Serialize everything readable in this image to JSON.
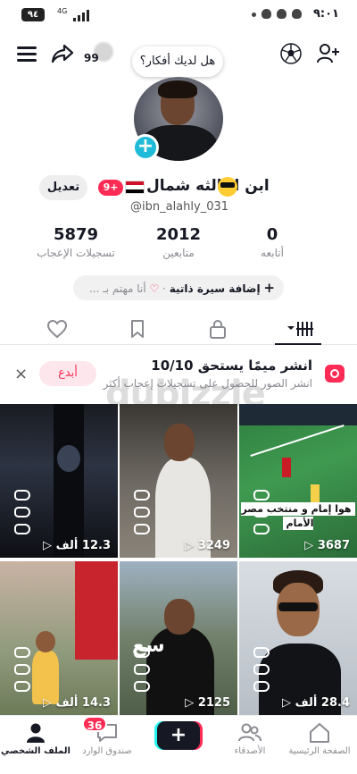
{
  "status_bar": {
    "battery": "٩٤",
    "network": "4G",
    "time": "٩:٠١"
  },
  "header": {
    "visitors_count": "99"
  },
  "profile": {
    "bubble": "هل لديك أفكار؟",
    "display_name": "ابن الثالثه شمال",
    "badge": "9+",
    "username": "@ibn_alahly_031",
    "edit_label": "تعديل"
  },
  "stats": [
    {
      "value": "0",
      "label": "أتابعه"
    },
    {
      "value": "2012",
      "label": "متابعين"
    },
    {
      "value": "5879",
      "label": "تسجيلات الإعجاب"
    }
  ],
  "bio": {
    "plus": "+",
    "add": "إضافة سيرة ذاتية",
    "sep": "·",
    "interest": "أنا مهتم بـ ..."
  },
  "promo": {
    "title": "انشر ميمًا يستحق 10/10",
    "subtitle": "انشر الصور للحصول على تسجيلات إعجاب أكثر",
    "create_label": "أبدع",
    "close": "×"
  },
  "watermark": "dubizzle",
  "videos": [
    {
      "views": "12.3 ألف ▷",
      "caption": "",
      "overlay": ""
    },
    {
      "views": "3249 ▷",
      "caption": "",
      "overlay": ""
    },
    {
      "views": "3687 ▷",
      "caption": "هوا إمام و منتخب مصر الأمام",
      "overlay": ""
    },
    {
      "views": "14.3 ألف ▷",
      "caption": "",
      "overlay": ""
    },
    {
      "views": "2125 ▷",
      "caption": "",
      "overlay": "سع"
    },
    {
      "views": "28.4 ألف ▷",
      "caption": "",
      "overlay": ""
    }
  ],
  "bottom_nav": {
    "home": "الصفحة الرئيسية",
    "friends": "الأصدقاء",
    "inbox": "صندوق الوارد",
    "inbox_count": "36",
    "profile": "الملف الشخصي",
    "plus": "+"
  },
  "colors": {
    "accent": "#fe2c55",
    "cyan": "#25f4ee",
    "add_badge": "#20bbd8"
  }
}
